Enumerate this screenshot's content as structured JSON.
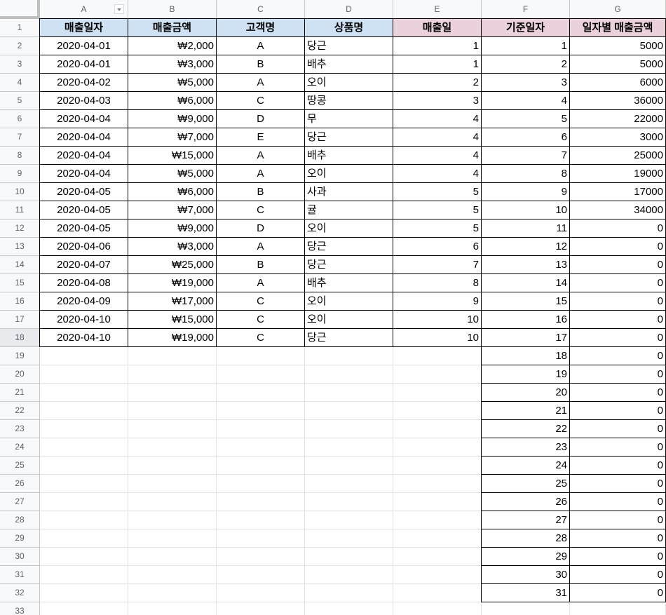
{
  "columns": [
    "A",
    "B",
    "C",
    "D",
    "E",
    "F",
    "G"
  ],
  "row_numbers": [
    "1",
    "2",
    "3",
    "4",
    "5",
    "6",
    "7",
    "8",
    "9",
    "10",
    "11",
    "12",
    "13",
    "14",
    "15",
    "16",
    "17",
    "18",
    "19",
    "20",
    "21",
    "22",
    "23",
    "24",
    "25",
    "26",
    "27",
    "28",
    "29",
    "30",
    "31",
    "32",
    "33"
  ],
  "headers": {
    "A": "매출일자",
    "B": "매출금액",
    "C": "고객명",
    "D": "상품명",
    "E": "매출일",
    "F": "기준일자",
    "G": "일자별 매출금액"
  },
  "colors": {
    "header_blue": "#cfe2f3",
    "header_pink": "#ead1dc",
    "grid_border": "#000000"
  },
  "sales": [
    {
      "date": "2020-04-01",
      "amount": "₩2,000",
      "customer": "A",
      "product": "당근",
      "day": "1"
    },
    {
      "date": "2020-04-01",
      "amount": "₩3,000",
      "customer": "B",
      "product": "배추",
      "day": "1"
    },
    {
      "date": "2020-04-02",
      "amount": "₩5,000",
      "customer": "A",
      "product": "오이",
      "day": "2"
    },
    {
      "date": "2020-04-03",
      "amount": "₩6,000",
      "customer": "C",
      "product": "땅콩",
      "day": "3"
    },
    {
      "date": "2020-04-04",
      "amount": "₩9,000",
      "customer": "D",
      "product": "무",
      "day": "4"
    },
    {
      "date": "2020-04-04",
      "amount": "₩7,000",
      "customer": "E",
      "product": "당근",
      "day": "4"
    },
    {
      "date": "2020-04-04",
      "amount": "₩15,000",
      "customer": "A",
      "product": "배추",
      "day": "4"
    },
    {
      "date": "2020-04-04",
      "amount": "₩5,000",
      "customer": "A",
      "product": "오이",
      "day": "4"
    },
    {
      "date": "2020-04-05",
      "amount": "₩6,000",
      "customer": "B",
      "product": "사과",
      "day": "5"
    },
    {
      "date": "2020-04-05",
      "amount": "₩7,000",
      "customer": "C",
      "product": "귤",
      "day": "5"
    },
    {
      "date": "2020-04-05",
      "amount": "₩9,000",
      "customer": "D",
      "product": "오이",
      "day": "5"
    },
    {
      "date": "2020-04-06",
      "amount": "₩3,000",
      "customer": "A",
      "product": "당근",
      "day": "6"
    },
    {
      "date": "2020-04-07",
      "amount": "₩25,000",
      "customer": "B",
      "product": "당근",
      "day": "7"
    },
    {
      "date": "2020-04-08",
      "amount": "₩19,000",
      "customer": "A",
      "product": "배추",
      "day": "8"
    },
    {
      "date": "2020-04-09",
      "amount": "₩17,000",
      "customer": "C",
      "product": "오이",
      "day": "9"
    },
    {
      "date": "2020-04-10",
      "amount": "₩15,000",
      "customer": "C",
      "product": "오이",
      "day": "10"
    },
    {
      "date": "2020-04-10",
      "amount": "₩19,000",
      "customer": "C",
      "product": "당근",
      "day": "10"
    }
  ],
  "daily": [
    {
      "ref": "1",
      "total": "5000"
    },
    {
      "ref": "2",
      "total": "5000"
    },
    {
      "ref": "3",
      "total": "6000"
    },
    {
      "ref": "4",
      "total": "36000"
    },
    {
      "ref": "5",
      "total": "22000"
    },
    {
      "ref": "6",
      "total": "3000"
    },
    {
      "ref": "7",
      "total": "25000"
    },
    {
      "ref": "8",
      "total": "19000"
    },
    {
      "ref": "9",
      "total": "17000"
    },
    {
      "ref": "10",
      "total": "34000"
    },
    {
      "ref": "11",
      "total": "0"
    },
    {
      "ref": "12",
      "total": "0"
    },
    {
      "ref": "13",
      "total": "0"
    },
    {
      "ref": "14",
      "total": "0"
    },
    {
      "ref": "15",
      "total": "0"
    },
    {
      "ref": "16",
      "total": "0"
    },
    {
      "ref": "17",
      "total": "0"
    },
    {
      "ref": "18",
      "total": "0"
    },
    {
      "ref": "19",
      "total": "0"
    },
    {
      "ref": "20",
      "total": "0"
    },
    {
      "ref": "21",
      "total": "0"
    },
    {
      "ref": "22",
      "total": "0"
    },
    {
      "ref": "23",
      "total": "0"
    },
    {
      "ref": "24",
      "total": "0"
    },
    {
      "ref": "25",
      "total": "0"
    },
    {
      "ref": "26",
      "total": "0"
    },
    {
      "ref": "27",
      "total": "0"
    },
    {
      "ref": "28",
      "total": "0"
    },
    {
      "ref": "29",
      "total": "0"
    },
    {
      "ref": "30",
      "total": "0"
    },
    {
      "ref": "31",
      "total": "0"
    }
  ]
}
